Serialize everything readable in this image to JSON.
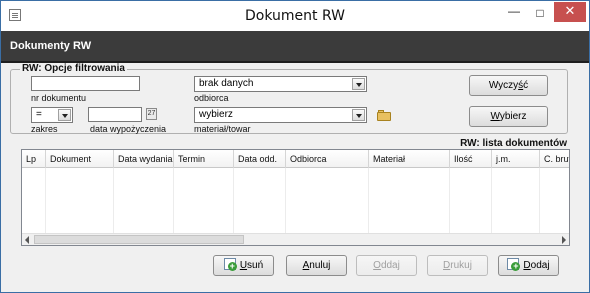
{
  "window": {
    "title": "Dokument RW",
    "minimize_glyph": "—",
    "maximize_glyph": "□",
    "close_glyph": "✕"
  },
  "header": {
    "title": "Dokumenty RW"
  },
  "filter": {
    "legend": "RW: Opcje filtrowania",
    "doc_number": {
      "value": "",
      "label": "nr dokumentu"
    },
    "recipient": {
      "value": "brak danych",
      "label": "odbiorca"
    },
    "range": {
      "value": "=",
      "label": "zakres"
    },
    "loan_date": {
      "value": "",
      "label": "data wypożyczenia",
      "calendar_glyph": "27"
    },
    "material": {
      "value": "wybierz",
      "label": "materiał/towar"
    },
    "clear_button": {
      "pre": "Wyczy",
      "mn": "ś",
      "post": "ć"
    },
    "select_button": {
      "pre": "",
      "mn": "W",
      "post": "ybierz"
    }
  },
  "list": {
    "title": "RW: lista dokumentów",
    "columns": [
      "Lp",
      "Dokument",
      "Data wydania",
      "Termin",
      "Data odd.",
      "Odbiorca",
      "Materiał",
      "Ilość",
      "j.m.",
      "C. brutto"
    ],
    "rows": []
  },
  "footer": {
    "delete_button": {
      "pre": "",
      "mn": "U",
      "post": "suń"
    },
    "cancel_button": {
      "pre": "",
      "mn": "A",
      "post": "nuluj"
    },
    "return_button": {
      "pre": "",
      "mn": "O",
      "post": "ddaj"
    },
    "print_button": {
      "pre": "",
      "mn": "D",
      "post": "rukuj"
    },
    "add_button": {
      "pre": "",
      "mn": "D",
      "post": "odaj"
    }
  },
  "icons": [
    "app-icon",
    "calendar-icon",
    "folder-icon",
    "document-icon",
    "add-document-icon",
    "scroll-left-icon",
    "scroll-right-icon"
  ]
}
